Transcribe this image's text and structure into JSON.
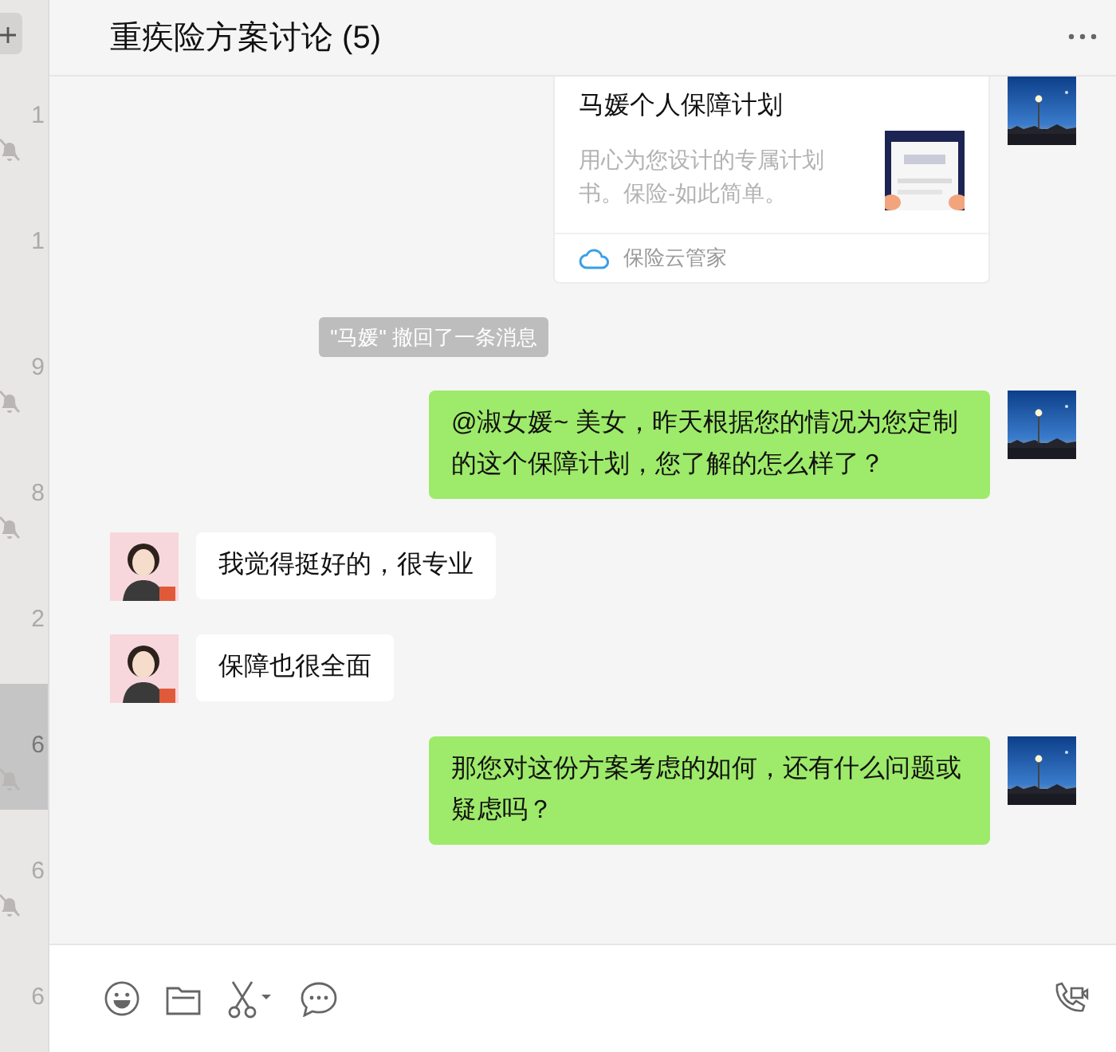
{
  "sidebar": {
    "items": [
      {
        "time": "1",
        "muted": true,
        "selected": false
      },
      {
        "time": "1",
        "muted": false,
        "selected": false
      },
      {
        "time": "9",
        "muted": true,
        "selected": false
      },
      {
        "time": "8",
        "muted": true,
        "selected": false
      },
      {
        "time": "2",
        "muted": false,
        "selected": false
      },
      {
        "time": "6",
        "muted": true,
        "selected": true
      },
      {
        "time": "6",
        "muted": true,
        "selected": false
      },
      {
        "time": "6",
        "muted": false,
        "selected": false
      }
    ]
  },
  "chat": {
    "title": "重疾险方案讨论 (5)",
    "messages": [
      {
        "kind": "card",
        "outgoing": true,
        "title": "马媛个人保障计划",
        "description": "用心为您设计的专属计划书。保险-如此简单。",
        "source": "保险云管家"
      },
      {
        "kind": "system",
        "text": "\"马媛\" 撤回了一条消息"
      },
      {
        "kind": "text",
        "outgoing": true,
        "text": "@淑女媛~ 美女，昨天根据您的情况为您定制的这个保障计划，您了解的怎么样了？"
      },
      {
        "kind": "text",
        "outgoing": false,
        "text": "我觉得挺好的，很专业"
      },
      {
        "kind": "text",
        "outgoing": false,
        "text": "保障也很全面"
      },
      {
        "kind": "text",
        "outgoing": true,
        "text": "那您对这份方案考虑的如何，还有什么问题或疑虑吗？"
      }
    ]
  }
}
